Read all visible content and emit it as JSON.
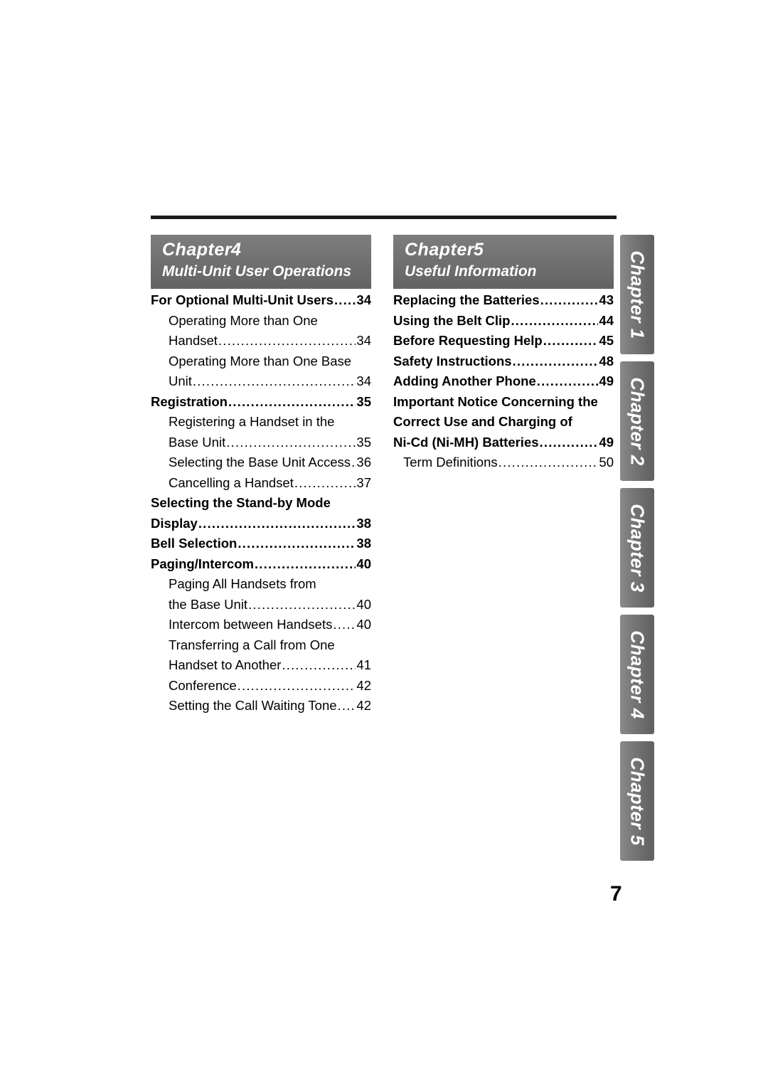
{
  "page": {
    "number": "7"
  },
  "chapters": [
    {
      "label": "Chapter",
      "number": "4",
      "title": "Multi-Unit User Operations"
    },
    {
      "label": "Chapter",
      "number": "5",
      "title": "Useful Information"
    }
  ],
  "toc_left": [
    {
      "text": "For Optional Multi-Unit Users",
      "page": "34",
      "bold": true,
      "indent": false,
      "dots": true
    },
    {
      "text": "Operating More than One",
      "page": "",
      "bold": false,
      "indent": true,
      "dots": false
    },
    {
      "text": "Handset",
      "page": "34",
      "bold": false,
      "indent": true,
      "dots": true
    },
    {
      "text": "Operating More than One Base",
      "page": "",
      "bold": false,
      "indent": true,
      "dots": false
    },
    {
      "text": "Unit",
      "page": "34",
      "bold": false,
      "indent": true,
      "dots": true
    },
    {
      "text": "Registration",
      "page": "35",
      "bold": true,
      "indent": false,
      "dots": true
    },
    {
      "text": "Registering a Handset in the",
      "page": "",
      "bold": false,
      "indent": true,
      "dots": false
    },
    {
      "text": "Base Unit",
      "page": "35",
      "bold": false,
      "indent": true,
      "dots": true
    },
    {
      "text": "Selecting the Base Unit Access",
      "page": "36",
      "bold": false,
      "indent": true,
      "dots": true
    },
    {
      "text": "Cancelling a Handset",
      "page": "37",
      "bold": false,
      "indent": true,
      "dots": true
    },
    {
      "text": "Selecting the Stand-by Mode",
      "page": "",
      "bold": true,
      "indent": false,
      "dots": false
    },
    {
      "text": "Display",
      "page": "38",
      "bold": true,
      "indent": false,
      "dots": true
    },
    {
      "text": "Bell Selection",
      "page": "38",
      "bold": true,
      "indent": false,
      "dots": true
    },
    {
      "text": "Paging/Intercom",
      "page": "40",
      "bold": true,
      "indent": false,
      "dots": true
    },
    {
      "text": "Paging All Handsets from",
      "page": "",
      "bold": false,
      "indent": true,
      "dots": false
    },
    {
      "text": "the Base Unit",
      "page": "40",
      "bold": false,
      "indent": true,
      "dots": true
    },
    {
      "text": "Intercom between Handsets",
      "page": "40",
      "bold": false,
      "indent": true,
      "dots": true
    },
    {
      "text": "Transferring a Call from One",
      "page": "",
      "bold": false,
      "indent": true,
      "dots": false
    },
    {
      "text": "Handset to Another",
      "page": "41",
      "bold": false,
      "indent": true,
      "dots": true
    },
    {
      "text": "Conference",
      "page": "42",
      "bold": false,
      "indent": true,
      "dots": true
    },
    {
      "text": "Setting the Call Waiting Tone",
      "page": "42",
      "bold": false,
      "indent": true,
      "dots": true
    }
  ],
  "toc_right": [
    {
      "text": "Replacing the Batteries",
      "page": "43",
      "bold": true,
      "indent": false,
      "dots": true
    },
    {
      "text": "Using the Belt Clip",
      "page": "44",
      "bold": true,
      "indent": false,
      "dots": true
    },
    {
      "text": "Before Requesting Help",
      "page": "45",
      "bold": true,
      "indent": false,
      "dots": true
    },
    {
      "text": "Safety Instructions",
      "page": "48",
      "bold": true,
      "indent": false,
      "dots": true
    },
    {
      "text": "Adding Another Phone",
      "page": "49",
      "bold": true,
      "indent": false,
      "dots": true
    },
    {
      "text": "Important Notice Concerning the",
      "page": "",
      "bold": true,
      "indent": false,
      "dots": false
    },
    {
      "text": "Correct Use and Charging of",
      "page": "",
      "bold": true,
      "indent": false,
      "dots": false
    },
    {
      "text": "Ni-Cd (Ni-MH) Batteries",
      "page": "49",
      "bold": true,
      "indent": false,
      "dots": true
    },
    {
      "text": "Term Definitions",
      "page": "50",
      "bold": false,
      "indent": true,
      "dots": true
    }
  ],
  "tabs": [
    {
      "label": "Chapter",
      "number": "1"
    },
    {
      "label": "Chapter",
      "number": "2"
    },
    {
      "label": "Chapter",
      "number": "3"
    },
    {
      "label": "Chapter",
      "number": "4"
    },
    {
      "label": "Chapter",
      "number": "5"
    }
  ]
}
